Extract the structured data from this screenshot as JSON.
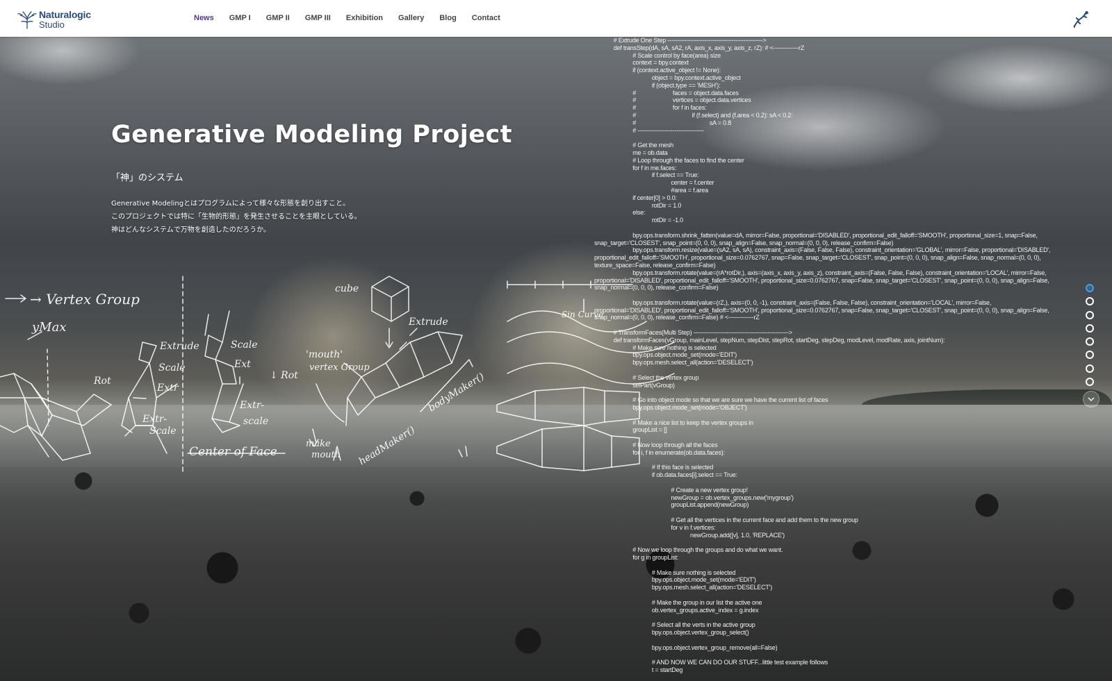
{
  "brand": {
    "name": "Naturalogic",
    "sub": "Studio"
  },
  "nav": {
    "active": "News",
    "items": [
      "News",
      "GMP I",
      "GMP II",
      "GMP III",
      "Exhibition",
      "Gallery",
      "Blog",
      "Contact"
    ]
  },
  "hero": {
    "title": "Generative Modeling Project",
    "subtitle": "「神」のシステム",
    "description": [
      "Generative Modelingとはプログラムによって様々な形態を創り出すこと。",
      "このプロジェクトでは特に「生物的形態」を発生させることを主眼としている。",
      "神はどんなシステムで万物を創造したのだろうか。"
    ]
  },
  "sketch_labels": [
    "Vertex Group",
    "Max",
    "Extrude",
    "Scale",
    "Extr",
    "Rot",
    "Extr-",
    "Scale",
    "Extrude",
    "Scale",
    "Rot",
    "Extr",
    "Extr-",
    "scale",
    "Center of Face",
    "cube",
    "Extrude",
    "'mouth' vertex Group",
    "make mouth",
    "headMaker()",
    "bodyMaker()",
    "Sin Curve"
  ],
  "code_lines": [
    "            # Extrude One Step ------------------------------------------------->",
    "            def transStep(dA, sA, sA2, rA, axis_x, axis_y, axis_z, rZ): # <-------------rZ",
    "                        # Scale control by face(area) size",
    "                        context = bpy.context",
    "                        if (context.active_object != None):",
    "                                    object = bpy.context.active_object",
    "                                    if (object.type == 'MESH'):",
    "                        #                       faces = object.data.faces",
    "                        #                       vertices = object.data.vertices",
    "                        #                       for f in faces:",
    "                        #                                   if (f.select) and (f.area < 0.2): sA < 0.2:",
    "                        #                                              sA = 0.8",
    "                        # ----------------------------------",
    "",
    "                        # Get the mesh",
    "                        me = ob.data",
    "                        # Loop through the faces to find the center",
    "                        for f in me.faces:",
    "                                    if f.select == True:",
    "                                                center = f.center",
    "                                                #area = f.area",
    "                        if center[0] > 0.0:",
    "                                    rotDir = 1.0",
    "                        else:",
    "                                    rotDir = -1.0",
    "",
    "                        bpy.ops.transform.shrink_fatten(value=dA, mirror=False, proportional='DISABLED', proportional_edit_falloff='SMOOTH', proportional_size=1, snap=False,",
    "snap_target='CLOSEST', snap_point=(0, 0, 0), snap_align=False, snap_normal=(0, 0, 0), release_confirm=False)",
    "                        bpy.ops.transform.resize(value=(sA2, sA, sA), constraint_axis=(False, False, False), constraint_orientation='GLOBAL', mirror=False, proportional='DISABLED',",
    "proportional_edit_falloff='SMOOTH', proportional_size=0.0762767, snap=False, snap_target='CLOSEST', snap_point=(0, 0, 0), snap_align=False, snap_normal=(0, 0, 0),",
    "texture_space=False, release_confirm=False)",
    "                        bpy.ops.transform.rotate(value=(rA*rotDir,), axis=(axis_x, axis_y, axis_z), constraint_axis=(False, False, False), constraint_orientation='LOCAL', mirror=False,",
    "proportional='DISABLED', proportional_edit_falloff='SMOOTH', proportional_size=0.0762767, snap=False, snap_target='CLOSEST', snap_point=(0, 0, 0), snap_align=False,",
    "snap_normal=(0, 0, 0), release_confirm=False)",
    "",
    "                        bpy.ops.transform.rotate(value=(rZ,), axis=(0, 0, -1), constraint_axis=(False, False, False), constraint_orientation='LOCAL', mirror=False,",
    "proportional='DISABLED', proportional_edit_falloff='SMOOTH', proportional_size=0.0762767, snap=False, snap_target='CLOSEST', snap_point=(0, 0, 0), snap_align=False,",
    "snap_normal=(0, 0, 0), release_confirm=False) # <-------------rZ",
    "",
    "            # TransformFaces(Multi Step) ------------------------------------------------->",
    "            def transformFaces(vGroup, mainLevel, stepNum, stepDist, stepRot, startDeg, stepDeg, modLevel, modRate, axis, jointNum):",
    "                        # Make sure nothing is selected",
    "                        bpy.ops.object.mode_set(mode='EDIT')",
    "                        bpy.ops.mesh.select_all(action='DESELECT')",
    "",
    "                        # Select the vertex group",
    "                        selPart(vGroup)",
    "",
    "                        # Go into object mode so that we are sure we have the current list of faces",
    "                        bpy.ops.object.mode_set(mode='OBJECT')",
    "",
    "                        # Make a nice list to keep the vertex groups in",
    "                        groupList = []",
    "",
    "                        # Now loop through all the faces",
    "                        for i, f in enumerate(ob.data.faces):",
    "",
    "                                    # If this face is selected",
    "                                    if ob.data.faces[i].select == True:",
    "",
    "                                                # Create a new vertex group!",
    "                                                newGroup = ob.vertex_groups.new('mygroup')",
    "                                                groupList.append(newGroup)",
    "",
    "                                                # Get all the vertices in the current face and add them to the new group",
    "                                                for v in f.vertices:",
    "                                                            newGroup.add([v], 1.0, 'REPLACE')",
    "",
    "                        # Now we loop through the groups and do what we want.",
    "                        for g in groupList:",
    "",
    "                                    # Make sure nothing is selected",
    "                                    bpy.ops.object.mode_set(mode='EDIT')",
    "                                    bpy.ops.mesh.select_all(action='DESELECT')",
    "",
    "                                    # Make the group in our list the active one",
    "                                    ob.vertex_groups.active_index = g.index",
    "",
    "                                    # Select all the verts in the active group",
    "                                    bpy.ops.object.vertex_group_select()",
    "",
    "                                    bpy.ops.object.vertex_group_remove(all=False)",
    "",
    "                                    # AND NOW WE CAN DO OUR STUFF...little test example follows",
    "                                    t = startDeg"
  ],
  "slides": {
    "count": 8,
    "active": 1
  },
  "icons": {
    "logo": "tree-icon",
    "gecko": "gecko-icon",
    "scroll": "chevron-down-icon"
  },
  "colors": {
    "nav_active": "#553489",
    "brand": "#2a4b7a",
    "dot_active": "#3aa0e8"
  }
}
